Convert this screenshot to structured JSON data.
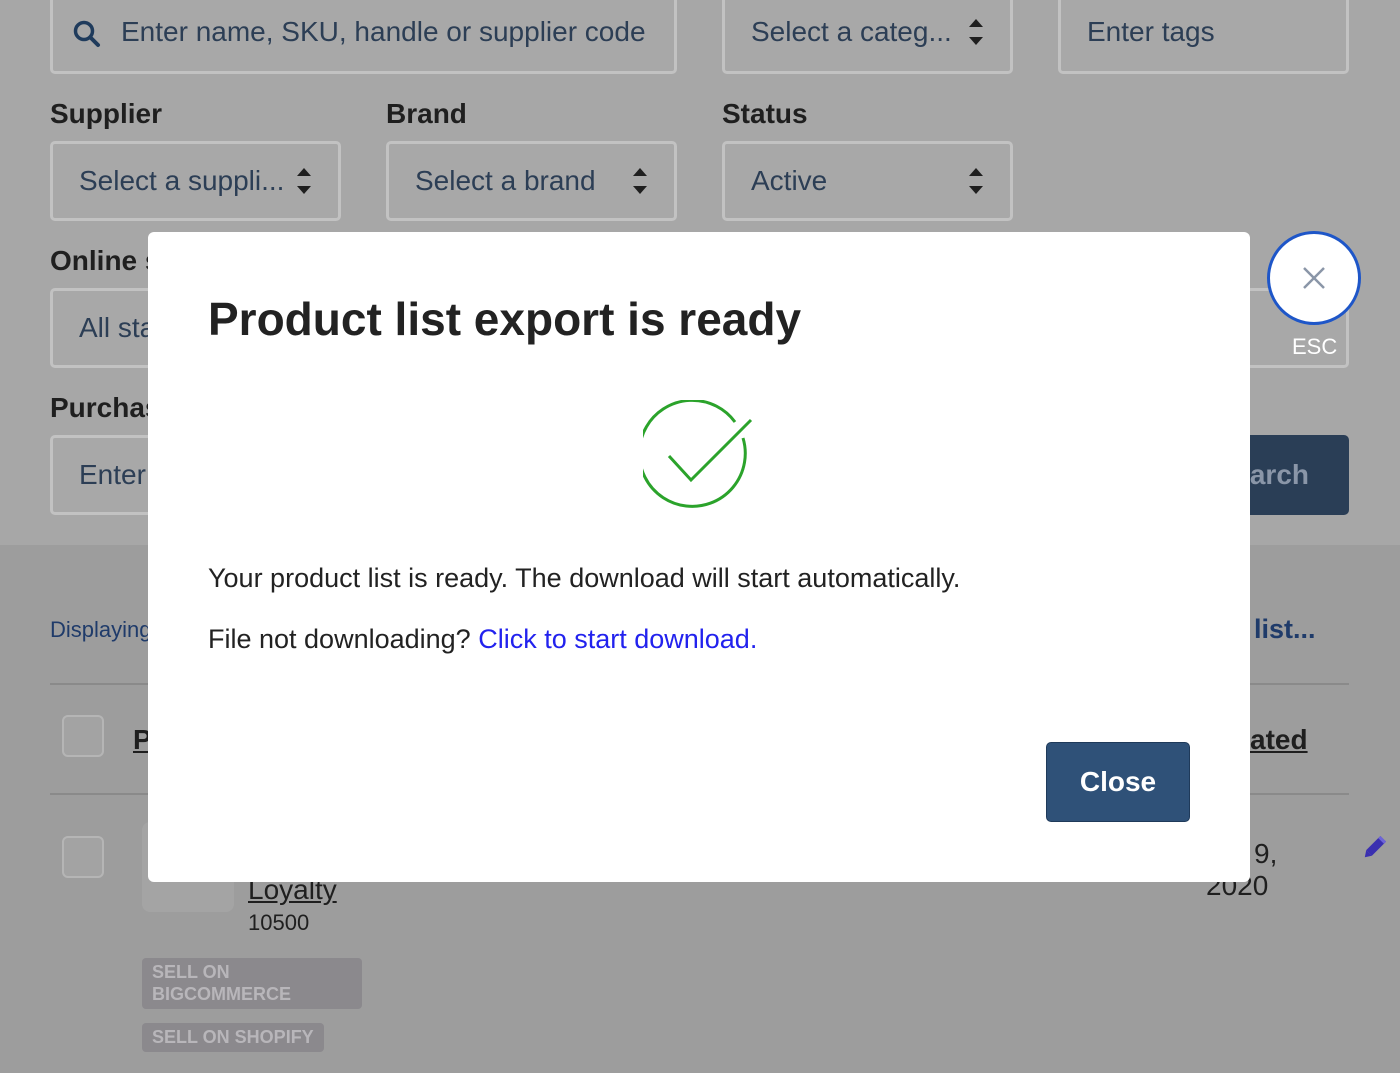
{
  "filters": {
    "search_placeholder": "Enter name, SKU, handle or supplier code",
    "category_placeholder": "Select a categ...",
    "tags_placeholder": "Enter tags",
    "supplier_label": "Supplier",
    "supplier_value": "Select a suppli...",
    "brand_label": "Brand",
    "brand_value": "Select a brand",
    "status_label": "Status",
    "status_value": "Active",
    "online_label": "Online s",
    "online_value": "All sta",
    "purchase_label": "Purchas",
    "purchase_value": "Enter",
    "search_button": "earch"
  },
  "list": {
    "displaying_text": "Displaying",
    "action_link": "list...",
    "header_left": "P",
    "header_right": "ated",
    "row": {
      "name": "Loyalty",
      "sku": "10500",
      "date_line1": "9,",
      "date_line2": "2020",
      "badges": [
        "SELL ON BIGCOMMERCE",
        "SELL ON SHOPIFY"
      ]
    }
  },
  "modal": {
    "title": "Product list export is ready",
    "message": "Your product list is ready. The download will start automatically.",
    "not_downloading": "File not downloading?",
    "download_link": "Click to start download.",
    "close_button": "Close"
  },
  "esc": {
    "label": "ESC"
  },
  "colors": {
    "success": "#2ba32b",
    "primary": "#2f5178",
    "link": "#2222ee",
    "esc_ring": "#1e56c8"
  },
  "icons": [
    "search-icon",
    "stepper-icon",
    "checkmark-circle-icon",
    "close-icon",
    "pencil-icon"
  ]
}
